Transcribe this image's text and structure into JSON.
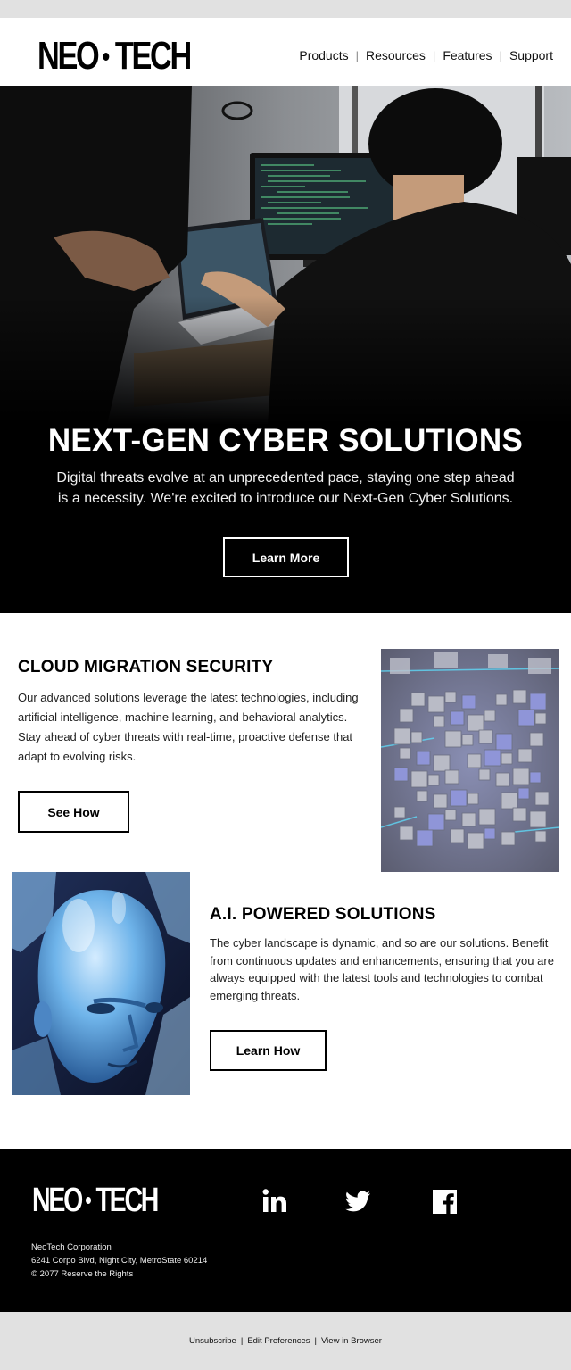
{
  "brand": {
    "logo_left": "NEO",
    "logo_right": "TECH"
  },
  "nav": {
    "items": [
      "Products",
      "Resources",
      "Features",
      "Support"
    ]
  },
  "hero": {
    "image_alt": "",
    "title": "NEXT-GEN CYBER SOLUTIONS",
    "text": "Digital threats evolve at an unprecedented pace, staying one step ahead is a necessity. We're excited to introduce our Next-Gen Cyber Solutions.",
    "button": "Learn More"
  },
  "section1": {
    "title": "CLOUD MIGRATION SECURITY",
    "text": "Our advanced solutions leverage the latest technologies, including artificial intelligence, machine learning, and behavioral analytics. Stay ahead of cyber threats with real-time, proactive defense that adapt to evolving risks.",
    "button": "See How"
  },
  "section2": {
    "title": "A.I. POWERED SOLUTIONS",
    "text": "The cyber landscape is dynamic, and so are our solutions. Benefit from continuous updates and enhancements, ensuring that you are always equipped with the latest tools and technologies to combat emerging threats.",
    "button": "Learn How"
  },
  "footer": {
    "company": "NeoTech Corporation",
    "address": "6241 Corpo Blvd, Night City, MetroState 60214",
    "copyright": "© 2077 Reserve the Rights",
    "social": [
      "linkedin-icon",
      "twitter-icon",
      "facebook-icon"
    ]
  },
  "bottom": {
    "unsubscribe": "Unsubscribe",
    "preferences": "Edit Preferences",
    "browser": "View in Browser"
  },
  "colors": {
    "background": "#e1e1e1",
    "hero_bg": "#000000",
    "footer_bg": "#000000",
    "card_bg": "#ffffff"
  }
}
